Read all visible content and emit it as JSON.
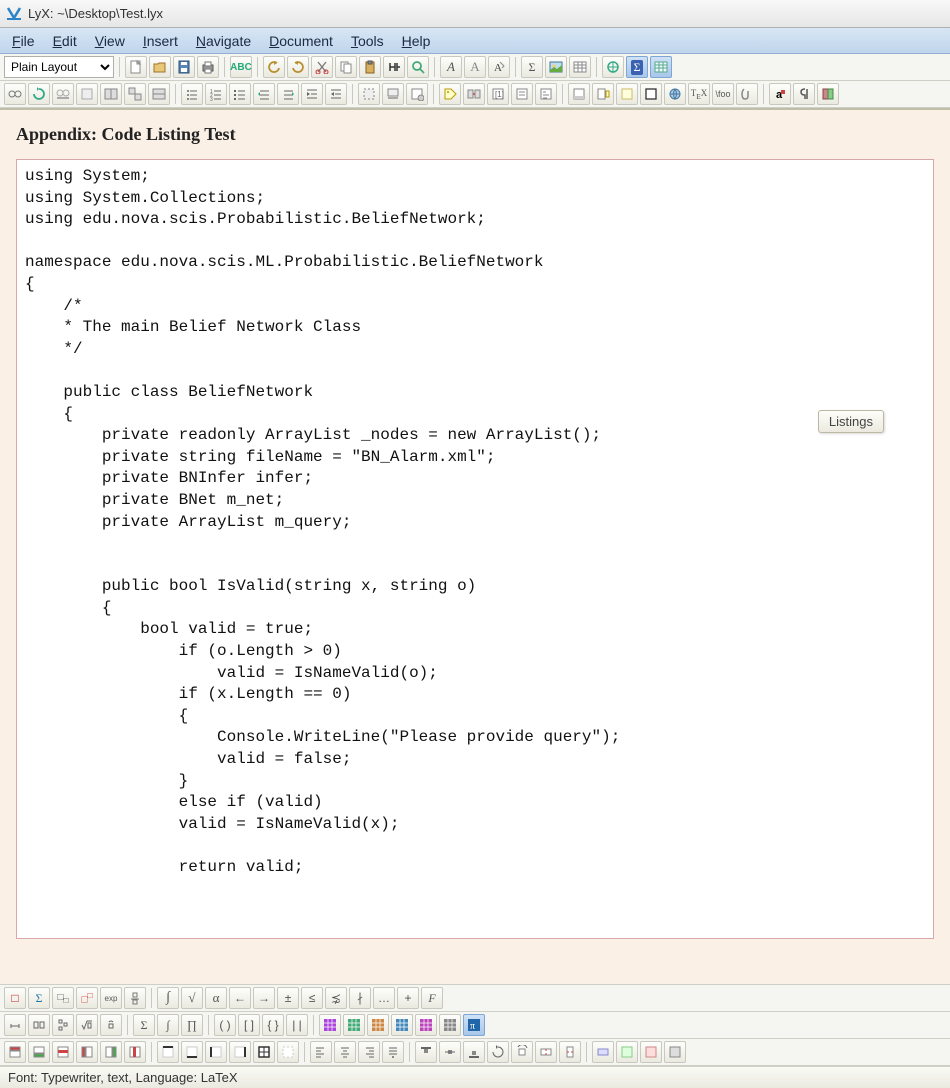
{
  "window": {
    "title": "LyX: ~\\Desktop\\Test.lyx"
  },
  "menus": {
    "file": "File",
    "edit": "Edit",
    "view": "View",
    "insert": "Insert",
    "navigate": "Navigate",
    "document": "Document",
    "tools": "Tools",
    "help": "Help"
  },
  "toolbar": {
    "layout_combo": "Plain Layout"
  },
  "document": {
    "section_heading": "Appendix: Code Listing Test",
    "listings_float_label": "Listings",
    "code": "using System;\nusing System.Collections;\nusing edu.nova.scis.Probabilistic.BeliefNetwork;\n\nnamespace edu.nova.scis.ML.Probabilistic.BeliefNetwork\n{\n    /*\n    * The main Belief Network Class\n    */\n\n    public class BeliefNetwork\n    {\n        private readonly ArrayList _nodes = new ArrayList();\n        private string fileName = \"BN_Alarm.xml\";\n        private BNInfer infer;\n        private BNet m_net;\n        private ArrayList m_query;\n\n\n        public bool IsValid(string x, string o)\n        {\n            bool valid = true;\n                if (o.Length > 0)\n                    valid = IsNameValid(o);\n                if (x.Length == 0)\n                {\n                    Console.WriteLine(\"Please provide query\");\n                    valid = false;\n                }\n                else if (valid)\n                valid = IsNameValid(x);\n\n                return valid;"
  },
  "statusbar": {
    "text": "Font: Typewriter, text, Language: LaTeX"
  },
  "math_toolbar": {
    "sigma": "Σ",
    "frac": "□",
    "atop": "▫",
    "prod": "Π",
    "exp_tan": "exp",
    "integral": "∫",
    "sqrt": "√",
    "alpha": "α",
    "leftarrow": "←",
    "rightarrow": "→",
    "pm": "±",
    "le": "≤",
    "lneq": "⋨",
    "dpr": "∤",
    "dots": "…",
    "plus": "+",
    "font": "F"
  }
}
